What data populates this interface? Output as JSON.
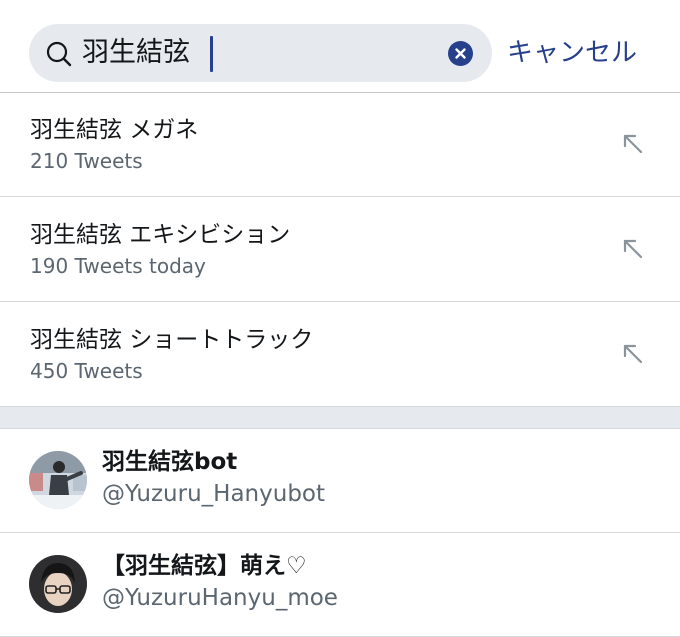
{
  "search": {
    "value": "羽生結弦",
    "cancel_label": "キャンセル",
    "icon": "magnifier-icon",
    "clear_icon": "clear-x-icon"
  },
  "suggestions": [
    {
      "title": "羽生結弦 メガネ",
      "subtitle": "210 Tweets",
      "action_icon": "fill-query-arrow-icon"
    },
    {
      "title": "羽生結弦 エキシビション",
      "subtitle": "190 Tweets today",
      "action_icon": "fill-query-arrow-icon"
    },
    {
      "title": "羽生結弦 ショートトラック",
      "subtitle": "450 Tweets",
      "action_icon": "fill-query-arrow-icon"
    }
  ],
  "users": [
    {
      "name": "羽生結弦bot",
      "handle": "@Yuzuru_Hanyubot",
      "avatar": "avatar-skater-photo"
    },
    {
      "name": "【羽生結弦】萌え♡",
      "handle": "@YuzuruHanyu_moe",
      "avatar": "avatar-portrait-glasses"
    }
  ],
  "colors": {
    "accent": "#26408b",
    "search_bg": "#e6eaee",
    "secondary_text": "#5b6670",
    "divider": "#d4d8dc"
  }
}
